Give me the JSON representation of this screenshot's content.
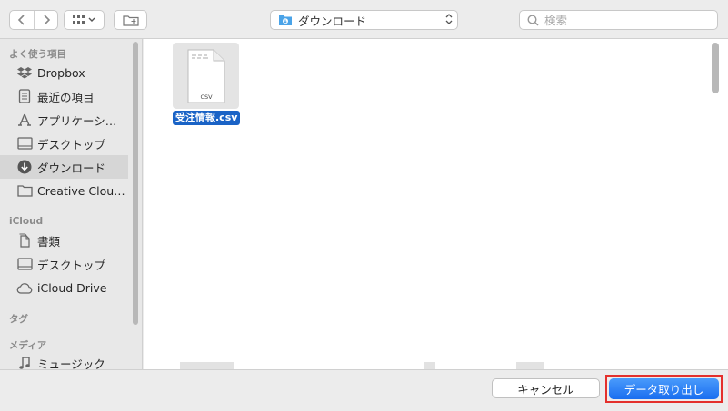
{
  "toolbar": {
    "back_icon": "chevron-left-icon",
    "forward_icon": "chevron-right-icon",
    "view_icon": "grid-view-icon",
    "new_folder_icon": "new-folder-icon",
    "location": "ダウンロード",
    "search_placeholder": "検索"
  },
  "sidebar": {
    "favorites_header": "よく使う項目",
    "favorites": [
      {
        "label": "Dropbox",
        "icon": "dropbox-icon"
      },
      {
        "label": "最近の項目",
        "icon": "recents-icon"
      },
      {
        "label": "アプリケーシ…",
        "icon": "applications-icon"
      },
      {
        "label": "デスクトップ",
        "icon": "desktop-icon"
      },
      {
        "label": "ダウンロード",
        "icon": "download-icon",
        "selected": true
      },
      {
        "label": "Creative Clou…",
        "icon": "folder-icon"
      }
    ],
    "icloud_header": "iCloud",
    "icloud": [
      {
        "label": "書類",
        "icon": "documents-icon"
      },
      {
        "label": "デスクトップ",
        "icon": "desktop-icon"
      },
      {
        "label": "iCloud Drive",
        "icon": "cloud-icon"
      }
    ],
    "tags_header": "タグ",
    "media_header": "メディア",
    "media": [
      {
        "label": "ミュージック",
        "icon": "music-icon"
      }
    ]
  },
  "main": {
    "file": {
      "name": "受注情報.csv",
      "type_label": "CSV"
    }
  },
  "footer": {
    "cancel_label": "キャンセル",
    "export_label": "データ取り出し"
  },
  "colors": {
    "accent": "#1a6ef0",
    "selection": "#1a63c6",
    "highlight_frame": "#e4302c"
  }
}
